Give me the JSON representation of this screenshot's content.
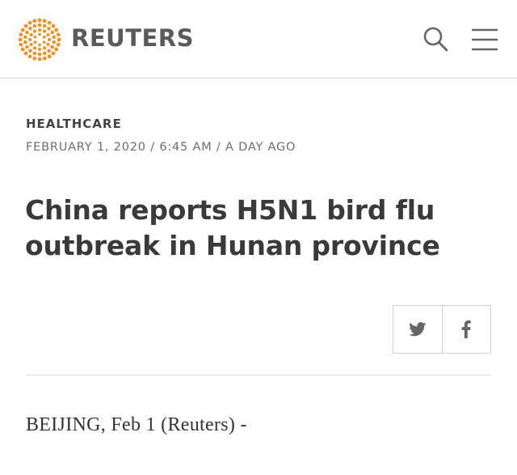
{
  "header": {
    "logo_text": "REUTERS",
    "logo_icon": "reuters-dot-logo",
    "search_icon": "search-icon",
    "menu_icon": "hamburger-menu-icon"
  },
  "article": {
    "section": "HEALTHCARE",
    "dateline": "FEBRUARY 1, 2020 / 6:45 AM / A DAY AGO",
    "headline": "China reports H5N1 bird flu outbreak in Hunan province",
    "share": {
      "twitter_icon": "twitter-icon",
      "facebook_icon": "facebook-icon"
    },
    "body_start": "BEIJING, Feb 1 (Reuters) -"
  },
  "colors": {
    "brand_orange": "#f29222",
    "text_dark": "#3a3a3a",
    "text_muted": "#6e6e6e",
    "divider": "#dddddd"
  }
}
